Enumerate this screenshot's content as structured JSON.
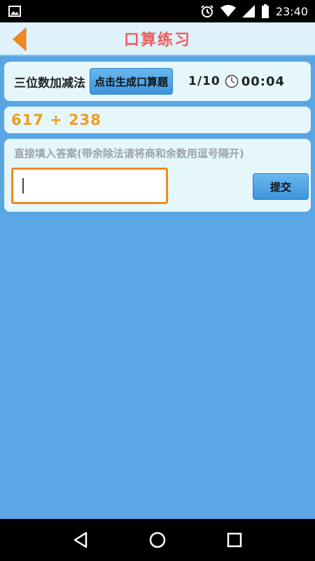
{
  "status_bar": {
    "time": "23:40",
    "icons": [
      "image-icon",
      "alarm-icon",
      "wifi-icon",
      "signal-icon",
      "battery-icon"
    ]
  },
  "header": {
    "title": "口算练习",
    "back_icon": "back-arrow-icon",
    "colors": {
      "title": "#e9605a",
      "back": "#f08a1e",
      "background": "#dff1fb"
    }
  },
  "toolbar": {
    "mode_label": "三位数加减法",
    "generate_label": "点击生成口算题",
    "progress": "1/10",
    "timer_icon": "stopwatch-icon",
    "timer": "00:04"
  },
  "question": {
    "text": "617 + 238",
    "color": "#f39a1e"
  },
  "answer": {
    "hint": "直接填入答案(带余除法请将商和余数用逗号隔开)",
    "value": "",
    "placeholder": "",
    "submit_label": "提交"
  },
  "nav_bar": {
    "icons": [
      "back-triangle-icon",
      "home-circle-icon",
      "recents-square-icon"
    ]
  },
  "colors": {
    "page_background": "#5aa6e4",
    "card_background": "#e6f7fb",
    "button": "#4fa5e6",
    "input_border": "#f08a1e"
  }
}
